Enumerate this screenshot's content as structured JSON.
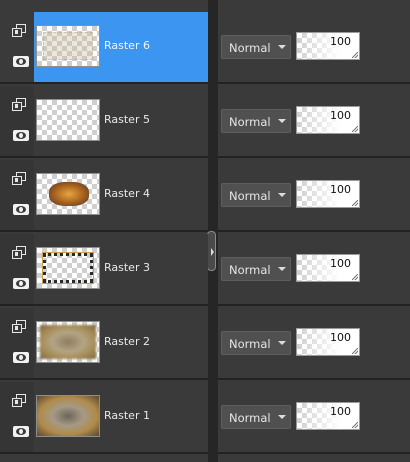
{
  "layers": [
    {
      "name": "Raster 6",
      "blend_mode": "Normal",
      "opacity": "100",
      "selected": true,
      "thumb": "faint"
    },
    {
      "name": "Raster 5",
      "blend_mode": "Normal",
      "opacity": "100",
      "selected": false,
      "thumb": "empty"
    },
    {
      "name": "Raster 4",
      "blend_mode": "Normal",
      "opacity": "100",
      "selected": false,
      "thumb": "blob"
    },
    {
      "name": "Raster 3",
      "blend_mode": "Normal",
      "opacity": "100",
      "selected": false,
      "thumb": "frame"
    },
    {
      "name": "Raster 2",
      "blend_mode": "Normal",
      "opacity": "100",
      "selected": false,
      "thumb": "blur"
    },
    {
      "name": "Raster 1",
      "blend_mode": "Normal",
      "opacity": "100",
      "selected": false,
      "thumb": "blur2"
    }
  ],
  "icons": {
    "group": "layer-group-icon",
    "visibility": "eye-icon",
    "dropdown": "chevron-down-icon",
    "splitter": "panel-splitter-handle"
  },
  "colors": {
    "selected_row": "#3c95f0",
    "panel_bg": "#3a3a3a"
  }
}
